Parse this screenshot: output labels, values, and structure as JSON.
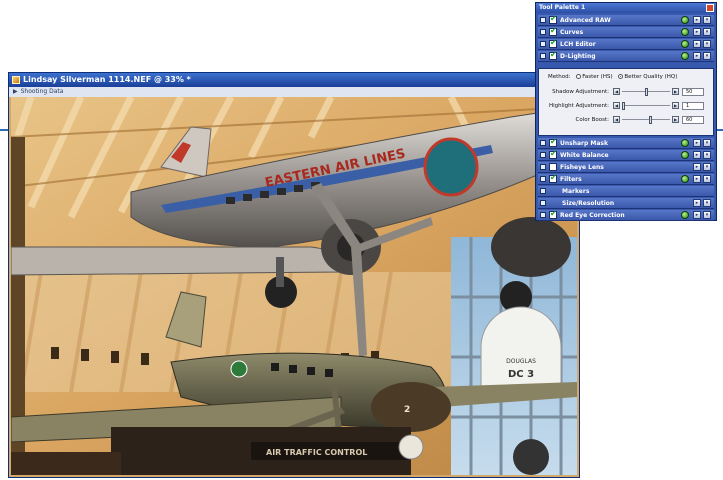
{
  "image_window": {
    "title": "Lindsay Silverman  1114.NEF @ 33% *",
    "infobar": "Shooting Data"
  },
  "sign_text": "DOUGLAS DC 3",
  "tower_text": "AIR TRAFFIC CONTROL",
  "tool_palette": {
    "title": "Tool Palette 1",
    "tools_top": [
      {
        "label": "Advanced RAW"
      },
      {
        "label": "Curves"
      },
      {
        "label": "LCH Editor"
      },
      {
        "label": "D-Lighting"
      }
    ],
    "d_lighting": {
      "method_label": "Method:",
      "option_faster": "Faster (HS)",
      "option_better": "Better Quality (HQ)",
      "selected": "Better Quality (HQ)",
      "sliders": [
        {
          "label": "Shadow Adjustment:",
          "value": "50",
          "level": 0.5
        },
        {
          "label": "Highlight Adjustment:",
          "value": "1",
          "level": 0.01
        },
        {
          "label": "Color Boost:",
          "value": "60",
          "level": 0.6
        }
      ]
    },
    "tools_bottom": [
      {
        "label": "Unsharp Mask",
        "checked": true
      },
      {
        "label": "White Balance",
        "checked": true
      },
      {
        "label": "Fisheye Lens",
        "checked": false
      },
      {
        "label": "Filters",
        "checked": true
      },
      {
        "label": "Markers",
        "checked": false
      },
      {
        "label": "Size/Resolution",
        "checked": false
      },
      {
        "label": "Red Eye Correction",
        "checked": true
      }
    ]
  }
}
